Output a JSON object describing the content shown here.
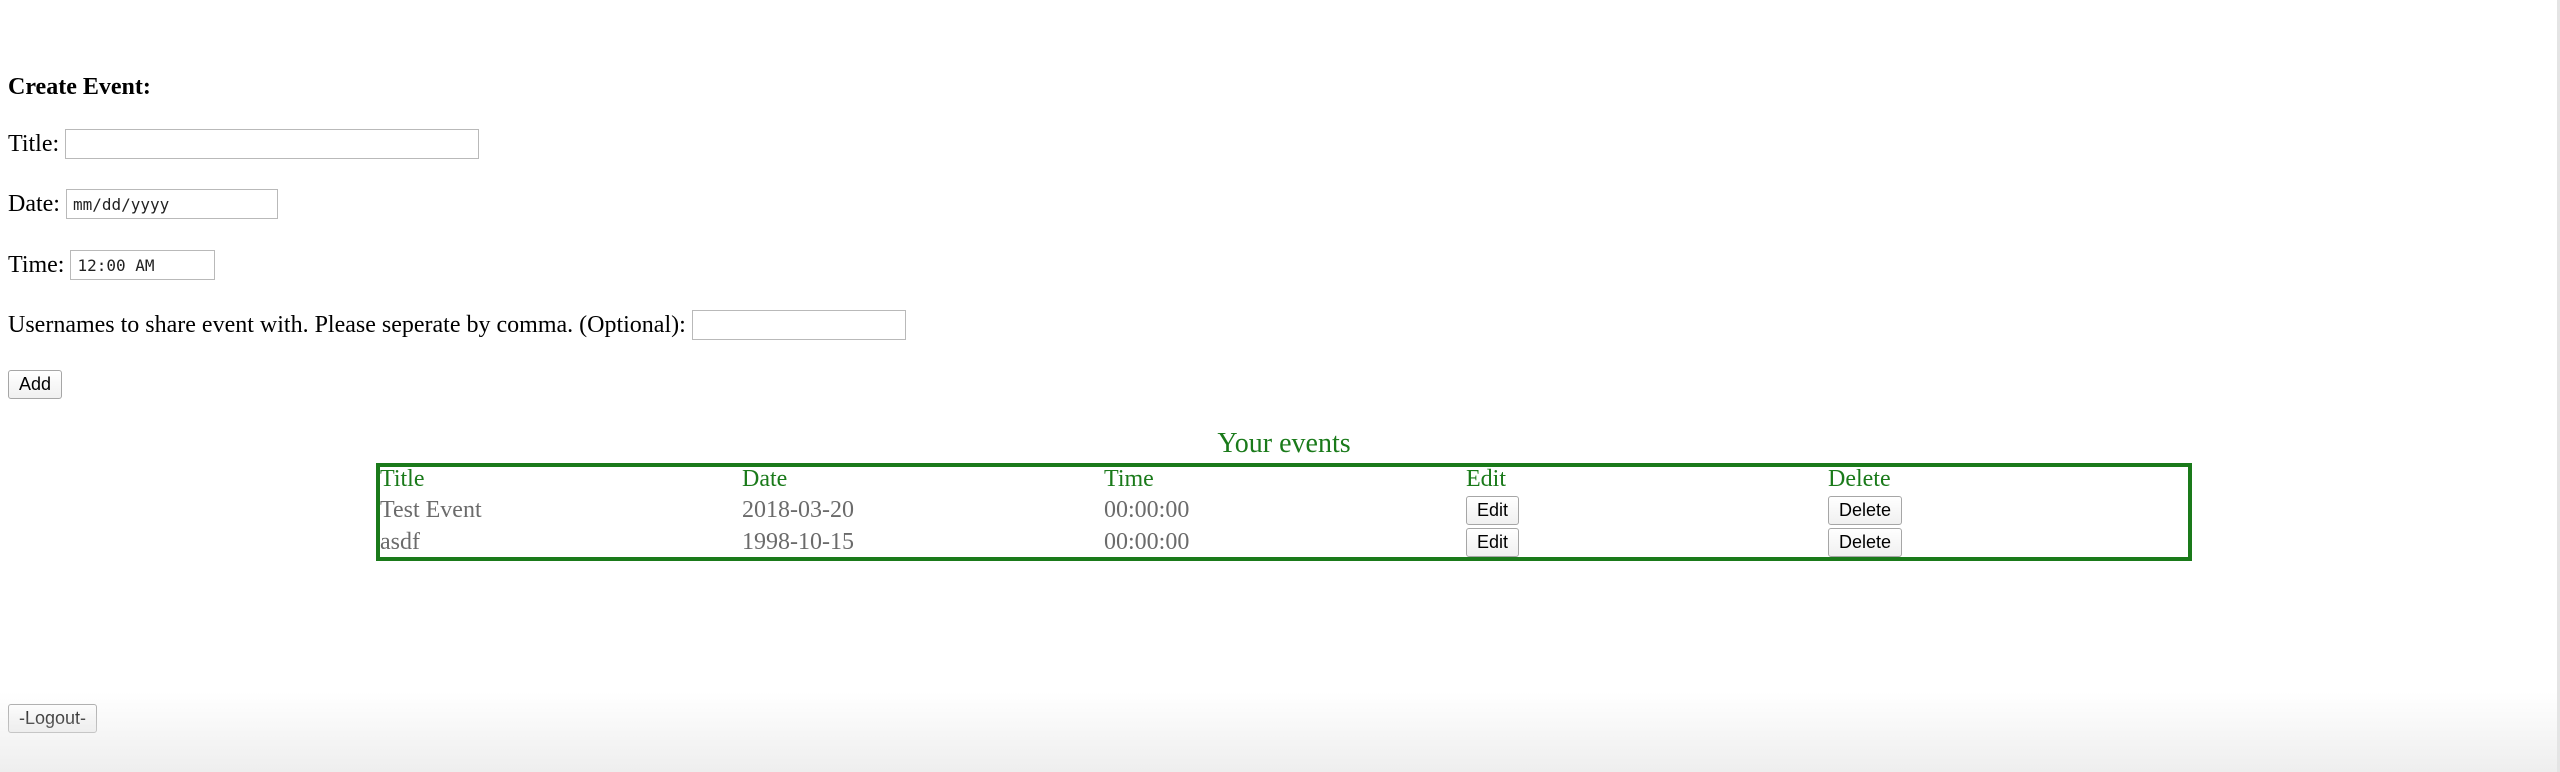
{
  "form": {
    "heading": "Create Event:",
    "title_label": "Title:",
    "title_value": "",
    "date_label": "Date:",
    "date_value": "mm/dd/yyyy",
    "time_label": "Time:",
    "time_value": "12:00 AM",
    "share_label": "Usernames to share event with. Please seperate by comma. (Optional):",
    "share_value": "",
    "add_label": "Add"
  },
  "events": {
    "caption": "Your events",
    "headers": [
      "Title",
      "Date",
      "Time",
      "Edit",
      "Delete"
    ],
    "rows": [
      {
        "title": "Test Event",
        "date": "2018-03-20",
        "time": "00:00:00",
        "edit_label": "Edit",
        "delete_label": "Delete"
      },
      {
        "title": "asdf",
        "date": "1998-10-15",
        "time": "00:00:00",
        "edit_label": "Edit",
        "delete_label": "Delete"
      }
    ]
  },
  "logout_label": "-Logout-",
  "colors": {
    "accent_green": "#1a7a1a",
    "row_text_gray": "#6b6b6b"
  }
}
